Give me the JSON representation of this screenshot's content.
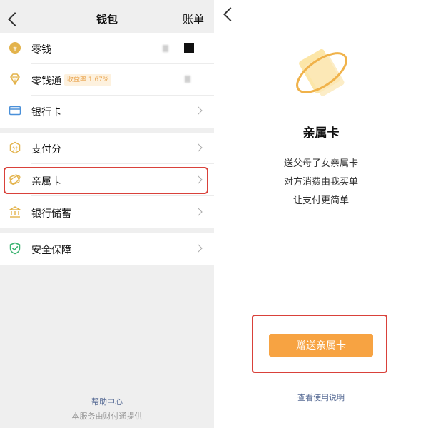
{
  "wallet": {
    "title": "钱包",
    "bill_label": "账单",
    "items": [
      {
        "label": "零钱",
        "icon": "coin-yen-icon"
      },
      {
        "label": "零钱通",
        "icon": "diamond-icon",
        "badge": "收益率 1.67%"
      },
      {
        "label": "银行卡",
        "icon": "bank-card-icon"
      },
      {
        "label": "支付分",
        "icon": "score-icon"
      },
      {
        "label": "亲属卡",
        "icon": "family-card-icon"
      },
      {
        "label": "银行储蓄",
        "icon": "bank-building-icon"
      },
      {
        "label": "安全保障",
        "icon": "shield-check-icon"
      }
    ],
    "help_link": "帮助中心",
    "provider_text": "本服务由财付通提供"
  },
  "family_card": {
    "title": "亲属卡",
    "lines": [
      "送父母子女亲属卡",
      "对方消费由我买单",
      "让支付更简单"
    ],
    "send_button": "赠送亲属卡",
    "usage_link": "查看使用说明"
  },
  "colors": {
    "accent_orange": "#f7a342",
    "icon_gold": "#e3b34c",
    "highlight_red": "#d9413a",
    "link_blue": "#576b95",
    "shield_green": "#3cb371"
  }
}
